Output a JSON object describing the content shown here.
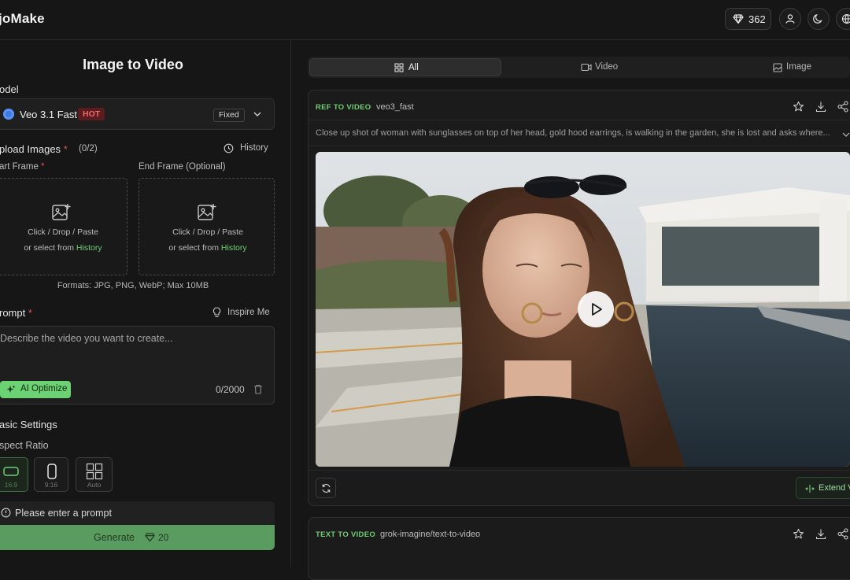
{
  "header": {
    "app_title": "joMake",
    "credits": "362",
    "icons": [
      "diamond-icon",
      "user-icon",
      "moon-icon",
      "globe-icon"
    ]
  },
  "left": {
    "title": "Image to Video",
    "model_label": "odel",
    "model": {
      "name": "Veo 3.1 Fast",
      "badge": "HOT",
      "fixed": "Fixed"
    },
    "upload": {
      "label": "pload Images",
      "count": "(0/2)",
      "history": "History",
      "start_label": "art Frame",
      "end_label": "End Frame (Optional)",
      "drop_text": "Click / Drop / Paste",
      "select_prefix": "or select from",
      "select_link": "History",
      "formats": "Formats: JPG, PNG, WebP; Max 10MB"
    },
    "prompt": {
      "label": "rompt",
      "inspire": "Inspire Me",
      "placeholder": "Describe the video you want to create...",
      "ai_optimize": "AI Optimize",
      "counter": "0/2000"
    },
    "settings": {
      "label": "asic Settings",
      "aspect_label": "spect Ratio",
      "ratios": [
        "16:9",
        "9:16",
        "Auto"
      ]
    },
    "warning": "Please enter a prompt",
    "generate": {
      "label": "Generate",
      "cost": "20"
    }
  },
  "right": {
    "tabs": [
      "All",
      "Video",
      "Image"
    ],
    "cards": [
      {
        "tag": "REF TO VIDEO",
        "model": "veo3_fast",
        "prompt": "Close up shot of woman with sunglasses on top of her head, gold hood earrings, is walking in the garden, she is lost and asks where...",
        "extend": "Extend V"
      },
      {
        "tag": "TEXT TO VIDEO",
        "model": "grok-imagine/text-to-video"
      }
    ]
  },
  "colors": {
    "accent_green": "#6fcf73",
    "hot_red": "#f06767",
    "bg": "#161616"
  }
}
